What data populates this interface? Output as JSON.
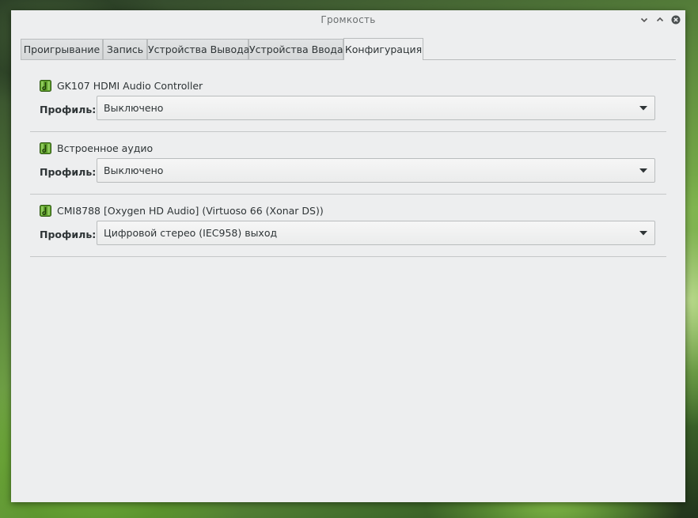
{
  "window": {
    "title": "Громкость"
  },
  "tabs": [
    {
      "label": "Проигрывание"
    },
    {
      "label": "Запись"
    },
    {
      "label": "Устройства Вывода"
    },
    {
      "label": "Устройства Ввода"
    },
    {
      "label": "Конфигурация",
      "active": true
    }
  ],
  "cards": [
    {
      "icon": "sound-card-icon",
      "name": "GK107 HDMI Audio Controller",
      "profile_label": "Профиль:",
      "profile_value": "Выключено"
    },
    {
      "icon": "sound-card-icon",
      "name": "Встроенное аудио",
      "profile_label": "Профиль:",
      "profile_value": "Выключено"
    },
    {
      "icon": "sound-card-icon",
      "name": "CMI8788 [Oxygen HD Audio] (Virtuoso 66 (Xonar DS))",
      "profile_label": "Профиль:",
      "profile_value": "Цифровой стерео (IEC958) выход"
    }
  ],
  "colors": {
    "window_bg": "#edeeef",
    "icon_green": "#5d9b2a"
  }
}
